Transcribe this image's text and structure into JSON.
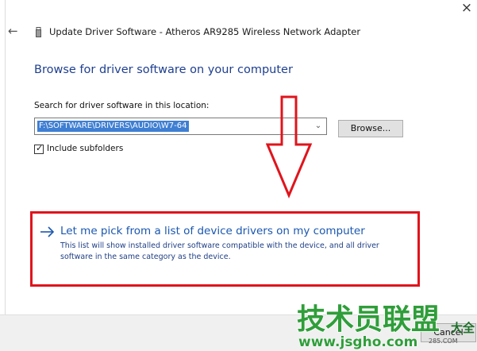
{
  "window": {
    "title": "Update Driver Software - Atheros AR9285 Wireless Network Adapter",
    "close_glyph": "×",
    "back_glyph": "←"
  },
  "main": {
    "heading": "Browse for driver software on your computer",
    "search_label": "Search for driver software in this location:",
    "path_value": "F:\\SOFTWARE\\DRIVERS\\AUDIO\\W7-64",
    "dropdown_glyph": "⌄",
    "browse_label": "Browse...",
    "include_subfolders": {
      "label": "Include subfolders",
      "checked": true
    }
  },
  "pick_option": {
    "link_text": "Let me pick from a list of device drivers on my computer",
    "description": "This list will show installed driver software compatible with the device, and all driver software in the same category as the device."
  },
  "footer": {
    "cancel_label": "Cancel"
  },
  "watermark": {
    "main": "技术员联盟",
    "url": "www.jsgho.com",
    "side": "大全",
    "small": "285.COM"
  },
  "colors": {
    "heading": "#1e3f8f",
    "link": "#1a57b0",
    "highlight_border": "#e0141c",
    "selection": "#3f7fd3",
    "watermark_green": "#2f9e3a"
  },
  "icons": {
    "title_icon": "usb-device-icon",
    "back": "back-arrow-icon",
    "close": "close-icon",
    "pick_arrow": "right-arrow-icon",
    "annotation": "red-down-arrow-icon"
  }
}
